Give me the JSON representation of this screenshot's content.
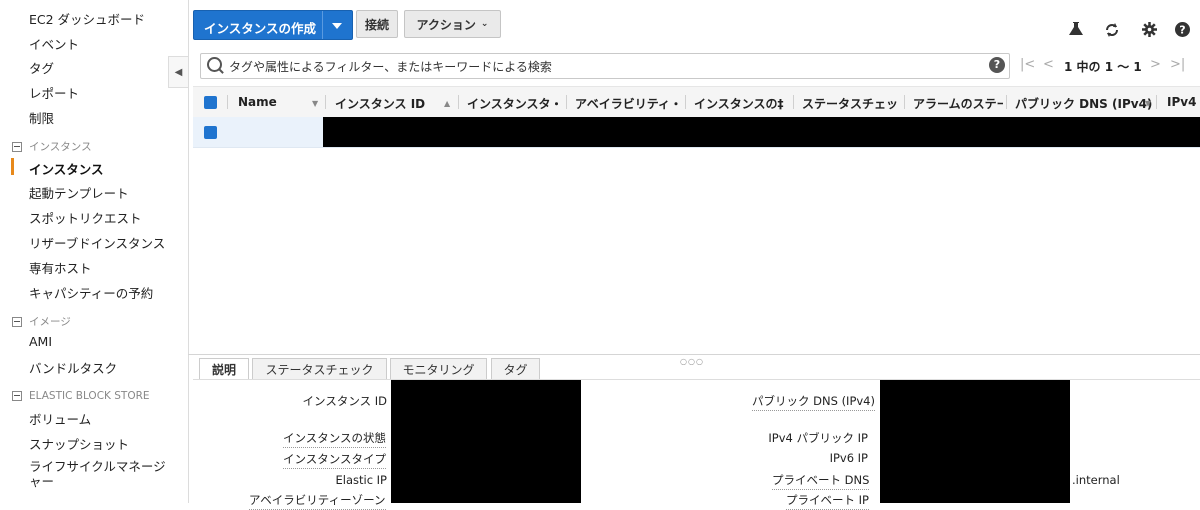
{
  "sidebar": {
    "items_top": [
      "EC2 ダッシュボード",
      "イベント",
      "タグ",
      "レポート",
      "制限"
    ],
    "group_instances": "インスタンス",
    "items_instances": [
      "インスタンス",
      "起動テンプレート",
      "スポットリクエスト",
      "リザーブドインスタンス",
      "専有ホスト",
      "キャパシティーの予約"
    ],
    "group_images": "イメージ",
    "items_images": [
      "AMI",
      "バンドルタスク"
    ],
    "group_ebs": "ELASTIC BLOCK STORE",
    "items_ebs": [
      "ボリューム",
      "スナップショット",
      "ライフサイクルマネージャー"
    ],
    "collapse_icon": "◀"
  },
  "toolbar": {
    "create_label": "インスタンスの作成",
    "connect_label": "接続",
    "actions_label": "アクション",
    "icons": [
      "flask-icon",
      "refresh-icon",
      "gear-icon",
      "help-icon"
    ]
  },
  "filter": {
    "placeholder": "タグや属性によるフィルター、またはキーワードによる検索",
    "help": "?"
  },
  "pager": {
    "text": "1 中の 1 ～ 1",
    "first": "|<",
    "prev": "<",
    "next": ">",
    "last": ">|"
  },
  "table": {
    "columns": [
      "Name",
      "インスタンス ID",
      "インスタンスタ・",
      "アベイラビリティ・",
      "インスタンスの‡",
      "ステータスチェッ・",
      "アラームのステー",
      "パブリック DNS (IPv4)",
      "IPv4"
    ]
  },
  "details": {
    "tabs": [
      "説明",
      "ステータスチェック",
      "モニタリング",
      "タグ"
    ],
    "left_labels": [
      "インスタンス ID",
      "インスタンスの状態",
      "インスタンスタイプ",
      "Elastic IP",
      "アベイラビリティーゾーン"
    ],
    "right_labels": [
      "パブリック DNS (IPv4)",
      "IPv4 パブリック IP",
      "IPv6 IP",
      "プライベート DNS",
      "プライベート IP"
    ],
    "internal_suffix": ".internal"
  },
  "colors": {
    "primary": "#1f74cf",
    "active_accent": "#e7891b"
  }
}
